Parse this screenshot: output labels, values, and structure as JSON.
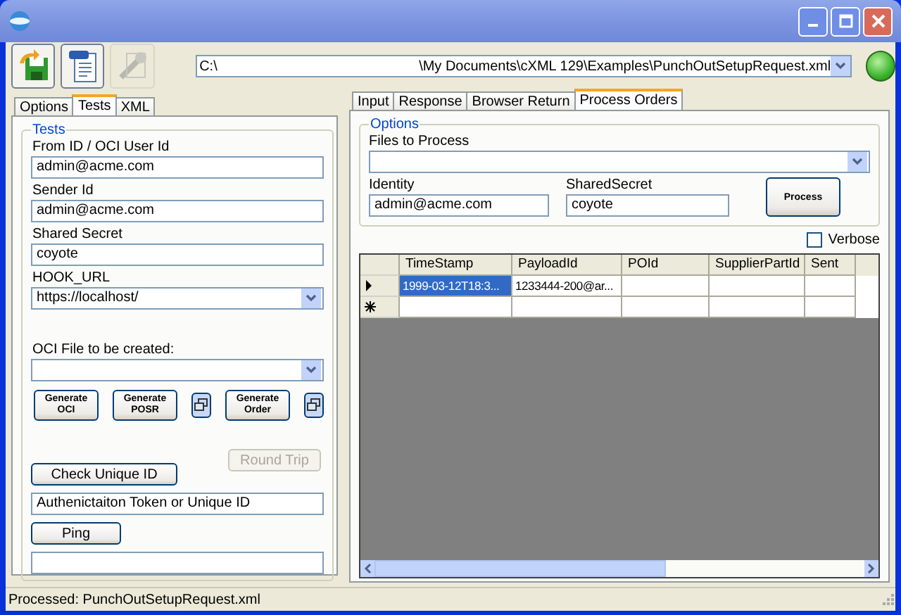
{
  "toolbar": {
    "buttons": [
      {
        "kind": "save",
        "disabled": false
      },
      {
        "kind": "xml",
        "disabled": false
      },
      {
        "kind": "tools",
        "disabled": true
      }
    ],
    "path_parts": [
      "C:\\",
      "\\My Documents\\cXML 129\\Examples\\PunchOutSetupRequest.xml"
    ],
    "connected": true
  },
  "left_tabs": [
    {
      "label": "Options",
      "selected": false
    },
    {
      "label": "Tests",
      "selected": true
    },
    {
      "label": "XML",
      "selected": false
    }
  ],
  "tests": {
    "title": "Tests",
    "fields": [
      {
        "kind": "text",
        "label": "From ID / OCI User Id",
        "value": "admin@acme.com"
      },
      {
        "kind": "text",
        "label": "Sender Id",
        "value": "admin@acme.com"
      },
      {
        "kind": "text",
        "label": "Shared Secret",
        "value": "coyote"
      },
      {
        "kind": "combo",
        "label": "HOOK_URL",
        "value": "https://localhost/"
      }
    ],
    "oci_file": {
      "label": "OCI File to be created:"
    },
    "generate": [
      {
        "kind": "button",
        "lines": [
          "Generate",
          "OCI"
        ]
      },
      {
        "kind": "button",
        "lines": [
          "Generate",
          "POSR"
        ]
      },
      {
        "kind": "icon"
      },
      {
        "kind": "button",
        "lines": [
          "Generate",
          "Order"
        ]
      },
      {
        "kind": "icon"
      }
    ],
    "round_trip": {
      "label": "Round Trip",
      "disabled": true
    },
    "check_unique": {
      "label": "Check Unique ID"
    },
    "token": {
      "value": "Authenictaiton Token or Unique ID"
    },
    "ping": {
      "label": "Ping"
    }
  },
  "right_tabs": [
    {
      "label": "Input",
      "selected": false
    },
    {
      "label": "Response",
      "selected": false
    },
    {
      "label": "Browser Return",
      "selected": false
    },
    {
      "label": "Process Orders",
      "selected": true
    }
  ],
  "options": {
    "title": "Options",
    "files_label": "Files to Process",
    "identity_label": "Identity",
    "identity": "admin@acme.com",
    "secret_label": "SharedSecret",
    "secret": "coyote",
    "process": "Process"
  },
  "verbose": {
    "label": "Verbose",
    "checked": false
  },
  "grid": {
    "columns": [
      "TimeStamp",
      "PayloadId",
      "POId",
      "SupplierPartId",
      "Sent"
    ],
    "rows": [
      {
        "kind": "current",
        "cells": [
          "1999-03-12T18:3...",
          "1233444-200@ar...",
          "",
          "",
          ""
        ],
        "selected": true
      },
      {
        "kind": "new",
        "cells": [
          "",
          "",
          "",
          "",
          ""
        ],
        "selected": false
      }
    ]
  },
  "status_bar": "Processed: PunchOutSetupRequest.xml"
}
